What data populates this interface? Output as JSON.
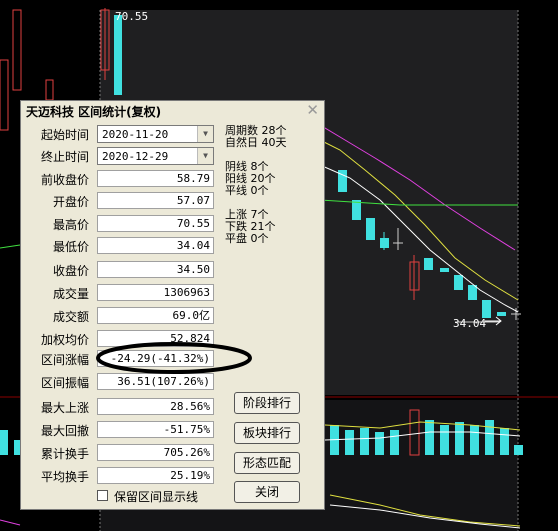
{
  "chart_labels": {
    "high_price": "70.55",
    "low_price": "34.04"
  },
  "dialog": {
    "title": "天迈科技 区间统计(复权)",
    "close_icon": "close-icon",
    "fields": [
      {
        "label": "起始时间",
        "value": "2020-11-20",
        "kind": "combo"
      },
      {
        "label": "终止时间",
        "value": "2020-12-29",
        "kind": "combo"
      },
      {
        "label": "前收盘价",
        "value": "58.79"
      },
      {
        "label": "开盘价",
        "value": "57.07"
      },
      {
        "label": "最高价",
        "value": "70.55"
      },
      {
        "label": "最低价",
        "value": "34.04"
      },
      {
        "label": "收盘价",
        "value": "34.50"
      },
      {
        "label": "成交量",
        "value": "1306963"
      },
      {
        "label": "成交额",
        "value": "69.0亿"
      },
      {
        "label": "加权均价",
        "value": "52.824"
      },
      {
        "label": "区间涨幅",
        "value": "-24.29(-41.32%)"
      },
      {
        "label": "区间振幅",
        "value": "36.51(107.26%)"
      },
      {
        "label": "最大上涨",
        "value": "28.56%"
      },
      {
        "label": "最大回撤",
        "value": "-51.75%"
      },
      {
        "label": "累计换手",
        "value": "705.26%"
      },
      {
        "label": "平均换手",
        "value": "25.19%"
      }
    ],
    "stats": {
      "period_count": "周期数 28个",
      "natural_days": "自然日 40天",
      "yin_line": "阴线 8个",
      "yang_line": "阳线 20个",
      "flat_line": "平线 0个",
      "up_count": "上涨 7个",
      "down_count": "下跌 21个",
      "flat_count": "平盘 0个"
    },
    "buttons": [
      "阶段排行",
      "板块排行",
      "形态匹配",
      "关闭"
    ],
    "checkbox_label": "保留区间显示线",
    "checkbox_checked": false
  }
}
